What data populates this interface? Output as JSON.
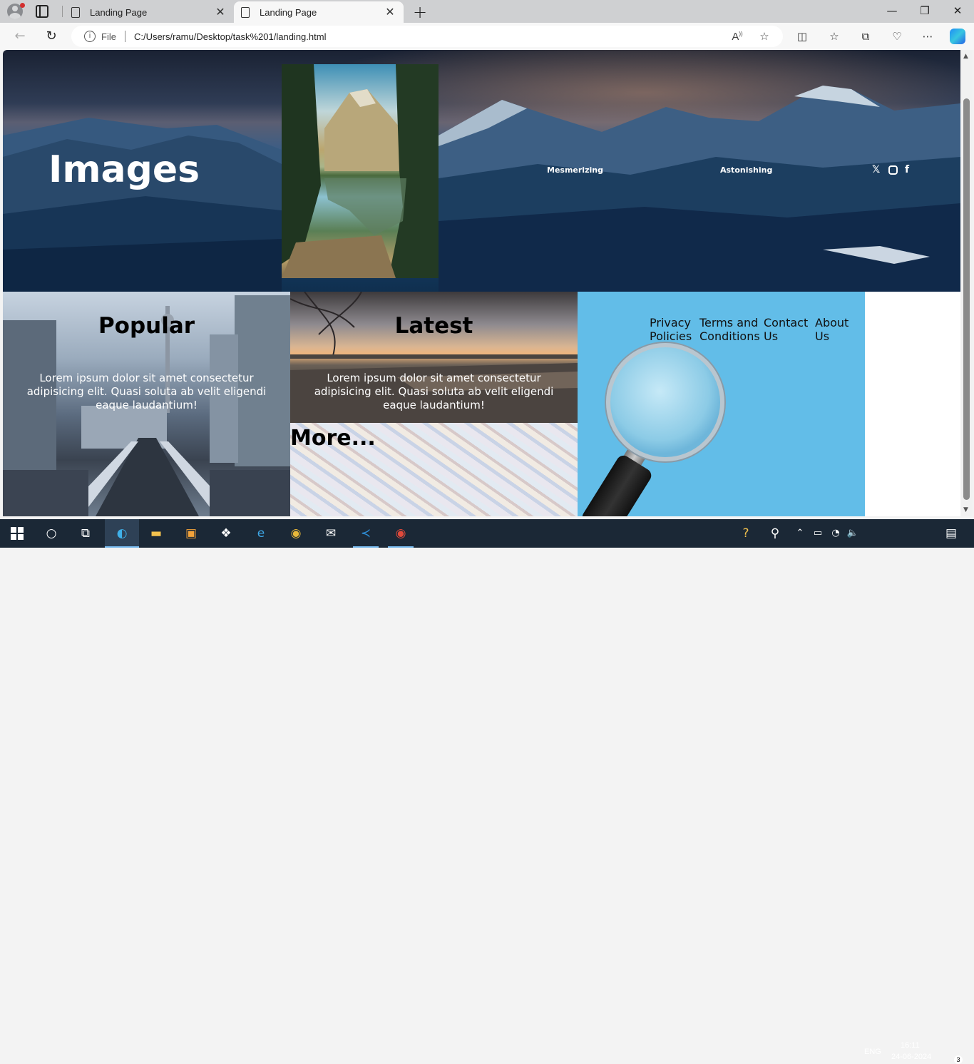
{
  "browser": {
    "tabs": [
      {
        "label": "Landing Page"
      },
      {
        "label": "Landing Page"
      }
    ],
    "address": {
      "scheme_label": "File",
      "url": "C:/Users/ramu/Desktop/task%201/landing.html"
    }
  },
  "page": {
    "hero": {
      "title": "Images",
      "links": [
        "Mesmerizing",
        "Astonishing"
      ],
      "social_icons": [
        "x-logo-icon",
        "instagram-icon",
        "facebook-icon"
      ]
    },
    "cards": {
      "popular": {
        "heading": "Popular",
        "text": "Lorem ipsum dolor sit amet consectetur adipisicing elit. Quasi soluta ab velit eligendi eaque laudantium!"
      },
      "latest": {
        "heading": "Latest",
        "text": "Lorem ipsum dolor sit amet consectetur adipisicing elit. Quasi soluta ab velit eligendi eaque laudantium!"
      },
      "more": {
        "heading": "More..."
      }
    },
    "footer_links": {
      "privacy": [
        "Privacy",
        "Policies"
      ],
      "terms": [
        "Terms and",
        "Conditions"
      ],
      "contact": [
        "Contact",
        "Us"
      ],
      "about": [
        "About",
        "Us"
      ]
    }
  },
  "taskbar": {
    "language": "ENG",
    "time": "16:11",
    "date": "24-06-2024",
    "notification_count": "3"
  }
}
